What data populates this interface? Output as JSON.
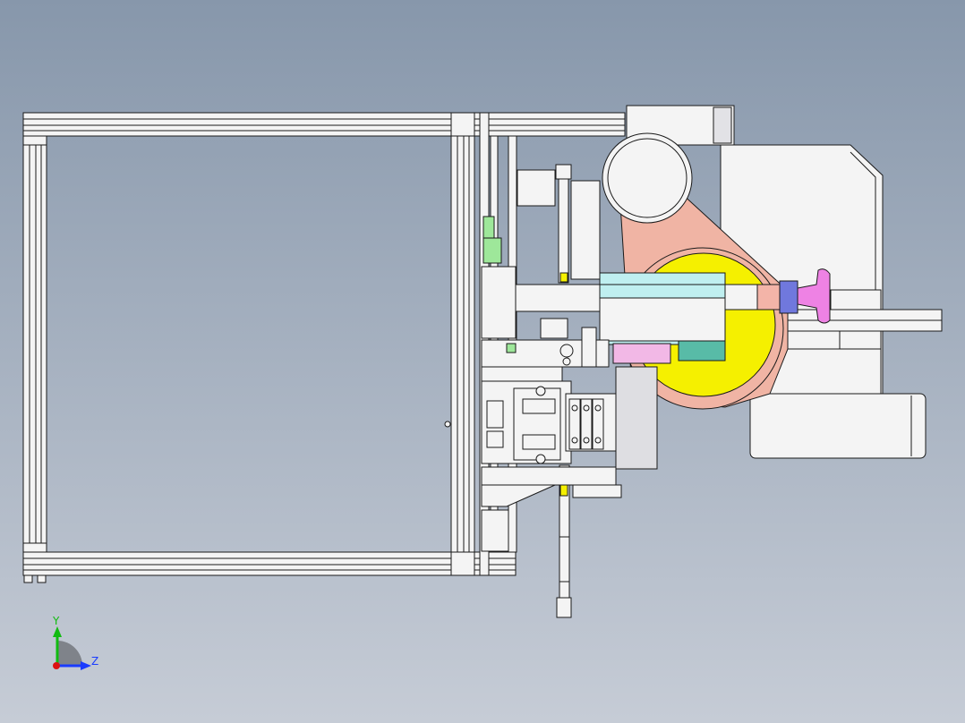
{
  "view": {
    "background_top": "#8797ab",
    "background_bottom": "#c6ccd6"
  },
  "triad": {
    "y_label": "Y",
    "z_label": "Z",
    "y_color": "#11bb11",
    "z_color": "#1a3cff",
    "origin_color": "#dd1111"
  },
  "model": {
    "line_color": "#1a1a1a",
    "part_fill": "#f4f4f4",
    "colors": {
      "salmon_arm": "#f0b4a4",
      "yellow_disc": "#f5f000",
      "cyan_block": "#bfeff0",
      "teal_block": "#58bba7",
      "pink_block": "#f2b8e6",
      "green_block": "#9ee79a",
      "blue_cap": "#7078dd",
      "magenta_knob": "#ee82e4"
    }
  }
}
